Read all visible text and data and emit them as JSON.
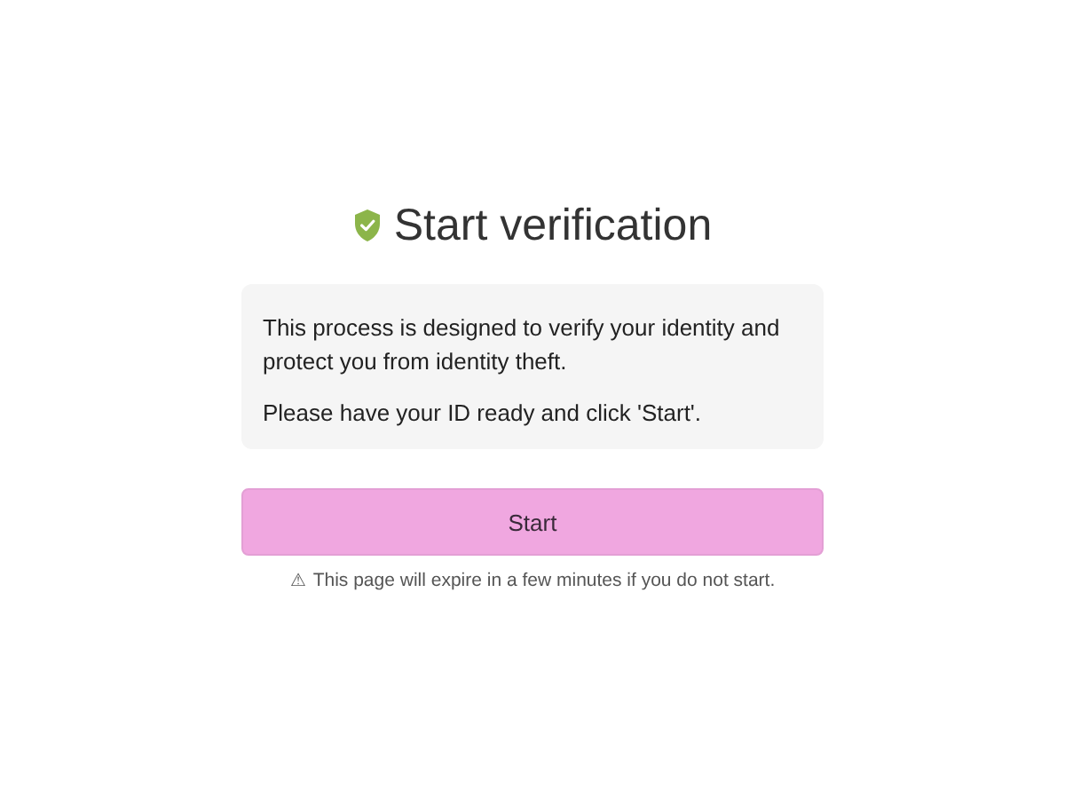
{
  "title": "Start verification",
  "info": [
    "This process is designed to verify your identity and protect you from identity theft.",
    "Please have your ID ready and click 'Start'."
  ],
  "button": "Start",
  "note": {
    "icon": "⚠",
    "text": "This page will expire in a few minutes if you do not start."
  }
}
